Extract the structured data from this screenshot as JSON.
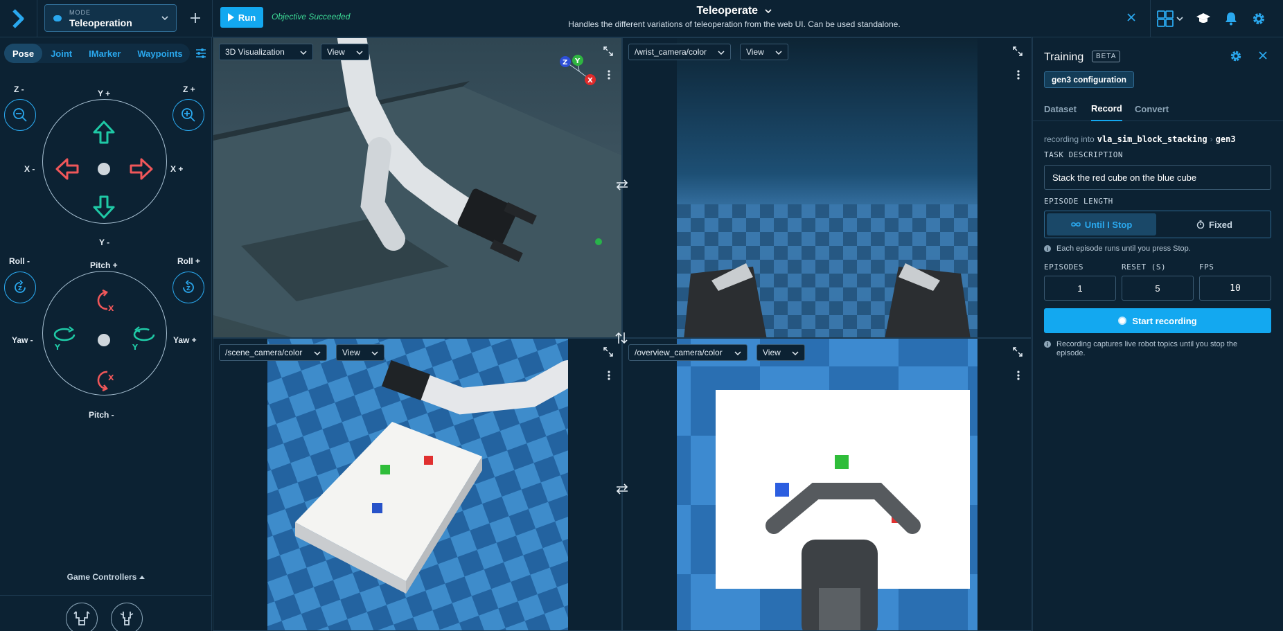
{
  "topbar": {
    "mode_label": "MODE",
    "mode_value": "Teleoperation",
    "run_label": "Run",
    "objective_status": "Objective Succeeded",
    "title": "Teleoperate",
    "subtitle": "Handles the different variations of teleoperation from the web UI. Can be used standalone."
  },
  "left": {
    "tabs": [
      {
        "label": "Pose",
        "active": true
      },
      {
        "label": "Joint"
      },
      {
        "label": "IMarker"
      },
      {
        "label": "Waypoints"
      }
    ],
    "z_minus": "Z -",
    "z_plus": "Z +",
    "y_plus": "Y +",
    "y_minus": "Y -",
    "x_minus": "X -",
    "x_plus": "X +",
    "roll_minus": "Roll -",
    "roll_plus": "Roll +",
    "pitch_plus": "Pitch +",
    "pitch_minus": "Pitch -",
    "yaw_minus": "Yaw -",
    "yaw_plus": "Yaw +",
    "axis_x": "X",
    "axis_y": "Y",
    "axis_z": "Z",
    "game_controllers": "Game Controllers"
  },
  "viewports": {
    "tl": {
      "select": "3D Visualization",
      "view": "View"
    },
    "tr": {
      "select": "/wrist_camera/color",
      "view": "View"
    },
    "bl": {
      "select": "/scene_camera/color",
      "view": "View"
    },
    "br": {
      "select": "/overview_camera/color",
      "view": "View"
    }
  },
  "right": {
    "title": "Training",
    "beta": "BETA",
    "config_chip": "gen3 configuration",
    "tabs": [
      "Dataset",
      "Record",
      "Convert"
    ],
    "active_tab": "Record",
    "recording_into": "recording into",
    "dataset_name": "vla_sim_block_stacking",
    "dataset_sep": "›",
    "dataset_config": "gen3",
    "task_description_label": "TASK DESCRIPTION",
    "task_description_value": "Stack the red cube on the blue cube",
    "episode_length_label": "EPISODE LENGTH",
    "until_stop": "Until I Stop",
    "fixed": "Fixed",
    "until_stop_info": "Each episode runs until you press Stop.",
    "episodes_label": "EPISODES",
    "reset_label": "RESET (S)",
    "fps_label": "FPS",
    "episodes_value": "1",
    "reset_value": "5",
    "fps_value": "10",
    "start_recording": "Start recording",
    "recording_info": "Recording captures live robot topics until you stop the episode."
  },
  "colors": {
    "accent": "#13a8f0",
    "success": "#3ddc97",
    "arrow_red": "#f0575a",
    "arrow_teal": "#1fc9a6",
    "background": "#0b1e2d"
  }
}
